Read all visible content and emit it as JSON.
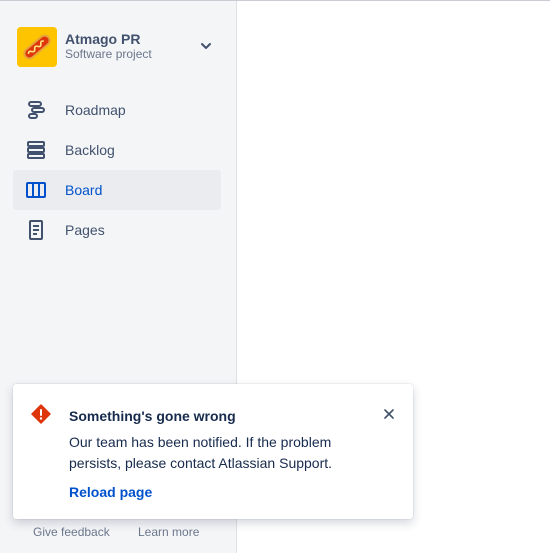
{
  "project": {
    "name": "Atmago PR",
    "type": "Software project",
    "avatar_icon": "hotdog-icon",
    "avatar_color": "#FFC400"
  },
  "nav": {
    "items": [
      {
        "label": "Roadmap",
        "icon": "roadmap-icon",
        "active": false
      },
      {
        "label": "Backlog",
        "icon": "backlog-icon",
        "active": false
      },
      {
        "label": "Board",
        "icon": "board-icon",
        "active": true
      },
      {
        "label": "Pages",
        "icon": "pages-icon",
        "active": false
      }
    ]
  },
  "footer": {
    "feedback_label": "Give feedback",
    "learn_more_label": "Learn more"
  },
  "flag": {
    "title": "Something's gone wrong",
    "body": "Our team has been notified. If the problem persists, please contact Atlassian Support.",
    "action_label": "Reload page",
    "icon": "error-icon",
    "icon_color": "#DE350B"
  },
  "colors": {
    "accent": "#0052CC",
    "sidebar_bg": "#F4F5F7",
    "active_bg": "#EBECF0"
  }
}
